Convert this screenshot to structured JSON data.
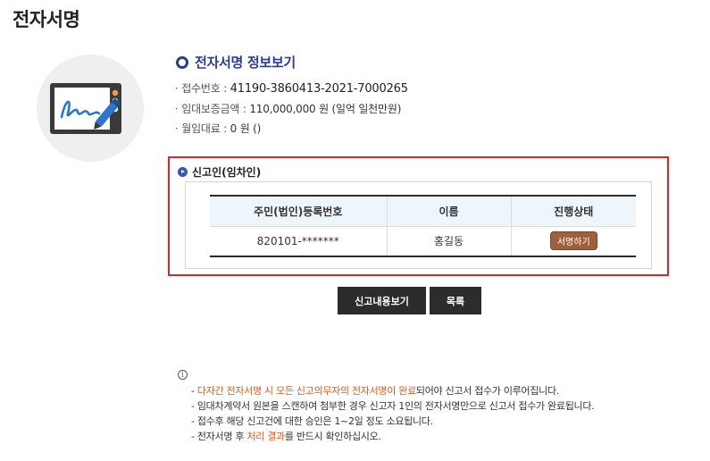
{
  "page": {
    "title": "전자서명"
  },
  "illustration": {
    "icon": "tablet-pen-icon",
    "colors": {
      "circle": "#efefef",
      "frame": "#3a3a3a",
      "screen": "#ffffff",
      "ink": "#2e76c9"
    }
  },
  "section": {
    "title": "전자서명 정보보기",
    "accent": "#2b3c8f"
  },
  "info": {
    "receipt_label": "· 접수번호 : ",
    "receipt_value": "41190-3860413-2021-7000265",
    "deposit_label": "· 임대보증금액 : ",
    "deposit_value": "110,000,000 원 (일억 일천만원)",
    "rent_label": "· 월임대료 : ",
    "rent_value": "0 원 ()"
  },
  "reporter": {
    "title": "신고인(임차인)",
    "columns": [
      "주민(법인)등록번호",
      "이름",
      "진행상태"
    ],
    "rows": [
      {
        "id_number": "820101-*******",
        "name": "홍길동",
        "status": "서명하기"
      }
    ],
    "highlight_color": "#e0242c"
  },
  "buttons": {
    "view": "신고내용보기",
    "list": "목록"
  },
  "notice": {
    "icon": "info-circle-icon",
    "items": [
      {
        "parts": [
          {
            "text": "- ",
            "red": false
          },
          {
            "text": "다자간 전자서명 시 모든 신고의무자의 전자서명이 완료",
            "red": true
          },
          {
            "text": "되어야 신고서 접수가 이루어집니다.",
            "red": false
          }
        ]
      },
      {
        "parts": [
          {
            "text": "- 임대차계약서 원본을 스캔하여 첨부한 경우 신고자 1인의 전자서명만으로 신고서 접수가 완료됩니다.",
            "red": false
          }
        ]
      },
      {
        "parts": [
          {
            "text": "- 접수후 해당 신고건에 대한 승인은 1~2일 정도 소요됩니다.",
            "red": false
          }
        ]
      },
      {
        "parts": [
          {
            "text": "- 전자서명 후 ",
            "red": false
          },
          {
            "text": "처리 결과",
            "red": true
          },
          {
            "text": "를 반드시 확인하십시오.",
            "red": false
          }
        ]
      }
    ],
    "highlight_color": "#e05a1c"
  }
}
